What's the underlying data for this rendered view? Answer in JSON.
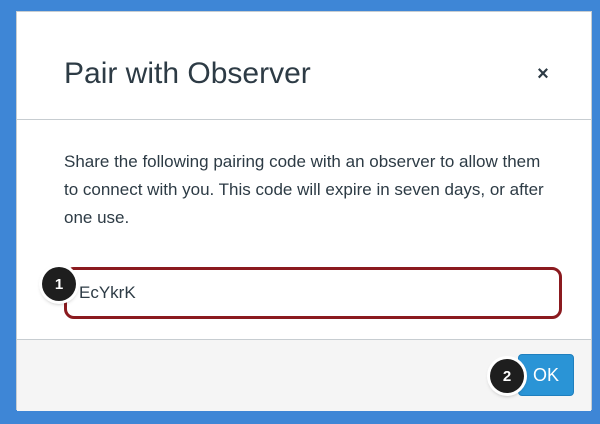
{
  "dialog": {
    "title": "Pair with Observer",
    "close_label": "×",
    "description": "Share the following pairing code with an observer to allow them to connect with you. This code will expire in seven days, or after one use.",
    "pairing_code": "EcYkrK",
    "ok_label": "OK"
  },
  "callouts": [
    {
      "label": "1"
    },
    {
      "label": "2"
    }
  ],
  "colors": {
    "background": "#3e86d6",
    "highlight_border": "#8b1a1f",
    "ok_button": "#2a94d6",
    "footer": "#f5f5f5"
  }
}
